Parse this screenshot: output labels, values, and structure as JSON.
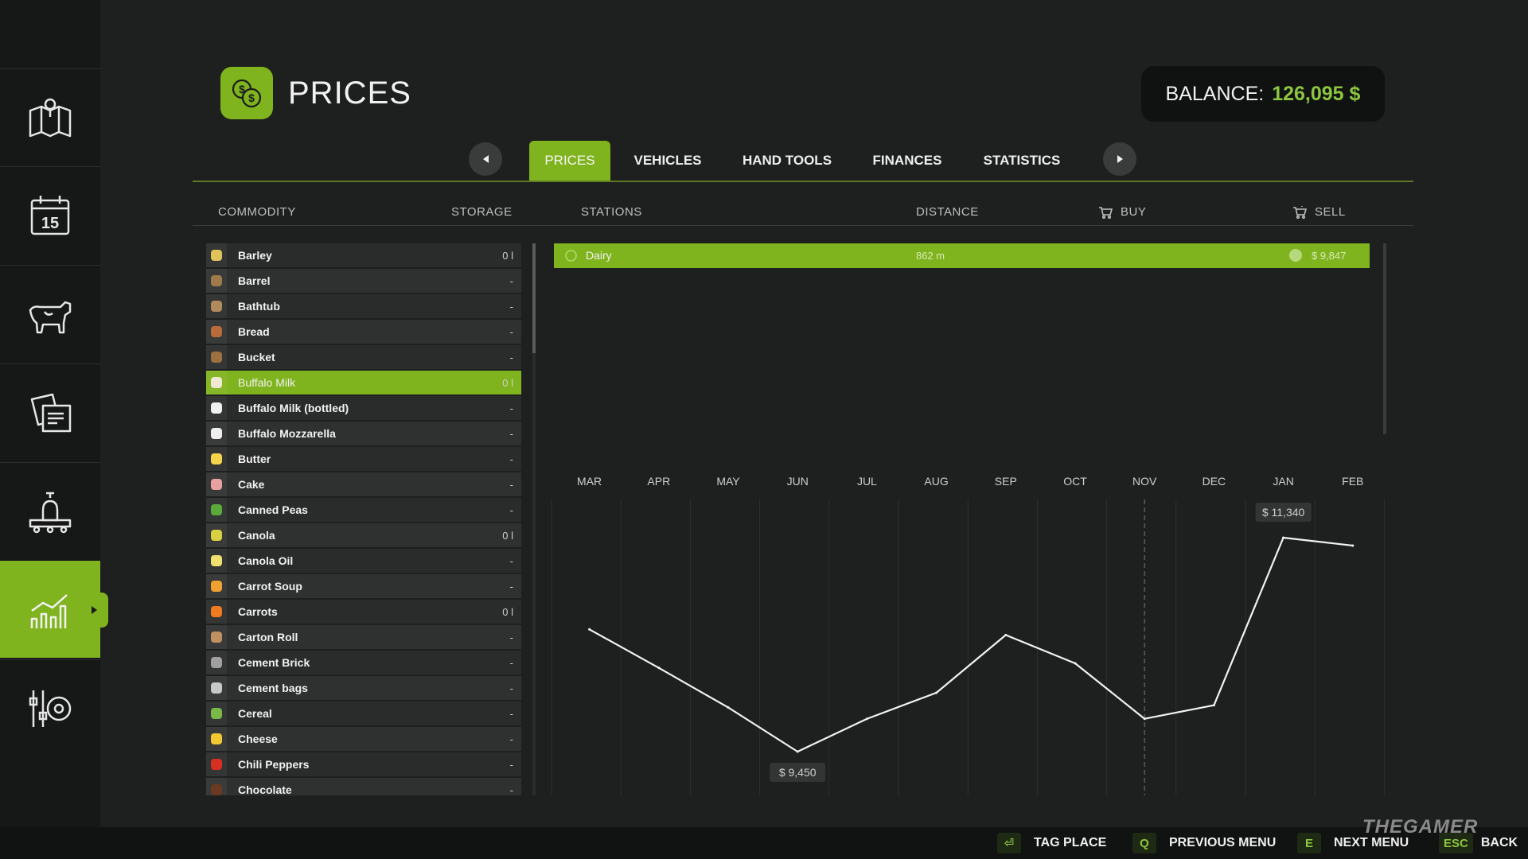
{
  "header": {
    "title": "PRICES",
    "balance_label": "BALANCE:",
    "balance_value": "126,095 $",
    "icon": "coins-icon"
  },
  "sidebar": {
    "items": [
      {
        "icon": "map-icon"
      },
      {
        "icon": "calendar-icon",
        "day": "15"
      },
      {
        "icon": "animals-icon"
      },
      {
        "icon": "contracts-icon"
      },
      {
        "icon": "production-icon"
      },
      {
        "icon": "prices-chart-icon",
        "active": true
      },
      {
        "icon": "settings-icon"
      }
    ]
  },
  "tabs": [
    {
      "label": "PRICES",
      "active": true
    },
    {
      "label": "VEHICLES"
    },
    {
      "label": "HAND TOOLS"
    },
    {
      "label": "FINANCES"
    },
    {
      "label": "STATISTICS"
    }
  ],
  "columns": {
    "commodity": "COMMODITY",
    "storage": "STORAGE",
    "stations": "STATIONS",
    "distance": "DISTANCE",
    "buy": "BUY",
    "sell": "SELL"
  },
  "commodities": [
    {
      "name": "Barley",
      "storage": "0 l",
      "color": "#e0c25a"
    },
    {
      "name": "Barrel",
      "storage": "-",
      "color": "#a07a4a"
    },
    {
      "name": "Bathtub",
      "storage": "-",
      "color": "#b08a5a"
    },
    {
      "name": "Bread",
      "storage": "-",
      "color": "#b86a38"
    },
    {
      "name": "Bucket",
      "storage": "-",
      "color": "#9c7040"
    },
    {
      "name": "Buffalo Milk",
      "storage": "0 l",
      "color": "#f0e8d0",
      "selected": true
    },
    {
      "name": "Buffalo Milk (bottled)",
      "storage": "-",
      "color": "#f0f0f0"
    },
    {
      "name": "Buffalo Mozzarella",
      "storage": "-",
      "color": "#eeeeee"
    },
    {
      "name": "Butter",
      "storage": "-",
      "color": "#f2d34a"
    },
    {
      "name": "Cake",
      "storage": "-",
      "color": "#e8a0a0"
    },
    {
      "name": "Canned Peas",
      "storage": "-",
      "color": "#5aaa3a"
    },
    {
      "name": "Canola",
      "storage": "0 l",
      "color": "#d8d040"
    },
    {
      "name": "Canola Oil",
      "storage": "-",
      "color": "#f0e070"
    },
    {
      "name": "Carrot Soup",
      "storage": "-",
      "color": "#f0a030"
    },
    {
      "name": "Carrots",
      "storage": "0 l",
      "color": "#f07a20"
    },
    {
      "name": "Carton Roll",
      "storage": "-",
      "color": "#c09060"
    },
    {
      "name": "Cement Brick",
      "storage": "-",
      "color": "#a0a0a0"
    },
    {
      "name": "Cement bags",
      "storage": "-",
      "color": "#c8c8c8"
    },
    {
      "name": "Cereal",
      "storage": "-",
      "color": "#7ab848"
    },
    {
      "name": "Cheese",
      "storage": "-",
      "color": "#f2c830"
    },
    {
      "name": "Chili Peppers",
      "storage": "-",
      "color": "#d83020"
    },
    {
      "name": "Chocolate",
      "storage": "-",
      "color": "#6a3a20"
    }
  ],
  "station": {
    "name": "Dairy",
    "distance": "862 m",
    "sell_price": "$ 9,847"
  },
  "chart_data": {
    "type": "line",
    "categories": [
      "MAR",
      "APR",
      "MAY",
      "JUN",
      "JUL",
      "AUG",
      "SEP",
      "OCT",
      "NOV",
      "DEC",
      "JAN",
      "FEB"
    ],
    "values": [
      10530,
      10190,
      9840,
      9450,
      9740,
      9970,
      10480,
      10230,
      9740,
      9860,
      11340,
      11270
    ],
    "min_label": "$ 9,450",
    "max_label": "$ 11,340",
    "current_month": "NOV"
  },
  "footer": {
    "hints": [
      {
        "key": "⏎",
        "label": "TAG PLACE"
      },
      {
        "key": "Q",
        "label": "PREVIOUS MENU"
      },
      {
        "key": "E",
        "label": "NEXT MENU"
      },
      {
        "key": "ESC",
        "label": "BACK"
      }
    ]
  },
  "watermark": "THEGAMER"
}
